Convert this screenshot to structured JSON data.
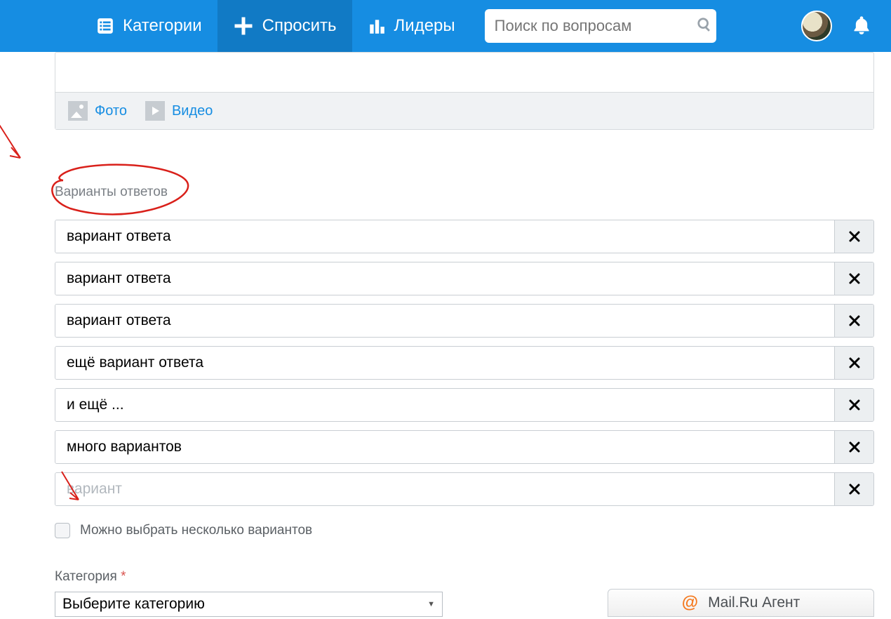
{
  "nav": {
    "categories": "Категории",
    "ask": "Спросить",
    "leaders": "Лидеры"
  },
  "search": {
    "placeholder": "Поиск по вопросам"
  },
  "toolbar": {
    "photo": "Фото",
    "video": "Видео"
  },
  "section": {
    "answer_options_label": "Варианты ответов"
  },
  "options": [
    {
      "value": "вариант ответа"
    },
    {
      "value": "вариант ответа"
    },
    {
      "value": "вариант ответа"
    },
    {
      "value": "ещё вариант ответа"
    },
    {
      "value": "и ещё ..."
    },
    {
      "value": "много вариантов"
    },
    {
      "value": "",
      "placeholder": "вариант"
    }
  ],
  "multi_select_label": "Можно выбрать несколько вариантов",
  "category": {
    "label": "Категория",
    "required_mark": "*",
    "placeholder": "Выберите категорию"
  },
  "agent_widget": "Mail.Ru Агент"
}
